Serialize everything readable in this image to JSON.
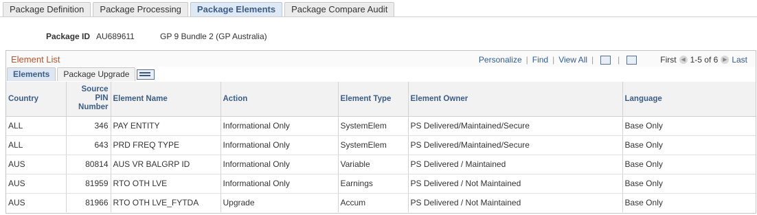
{
  "tabs": [
    "Package Definition",
    "Package Processing",
    "Package Elements",
    "Package Compare Audit"
  ],
  "package": {
    "label": "Package ID",
    "id": "AU689611",
    "description": "GP 9 Bundle 2 (GP Australia)"
  },
  "grid": {
    "title": "Element List",
    "nav": {
      "personalize": "Personalize",
      "find": "Find",
      "view_all": "View All",
      "first": "First",
      "range": "1-5 of 6",
      "last": "Last"
    },
    "subtabs": [
      "Elements",
      "Package Upgrade"
    ],
    "columns": [
      "Country",
      "Source PIN Number",
      "Element Name",
      "Action",
      "Element Type",
      "Element Owner",
      "Language"
    ],
    "rows": [
      [
        "ALL",
        "346",
        "PAY ENTITY",
        "Informational Only",
        "SystemElem",
        "PS Delivered/Maintained/Secure",
        "Base Only"
      ],
      [
        "ALL",
        "643",
        "PRD FREQ TYPE",
        "Informational Only",
        "SystemElem",
        "PS Delivered/Maintained/Secure",
        "Base Only"
      ],
      [
        "AUS",
        "80814",
        "AUS VR BALGRP ID",
        "Informational Only",
        "Variable",
        "PS Delivered / Maintained",
        "Base Only"
      ],
      [
        "AUS",
        "81959",
        "RTO OTH LVE",
        "Informational Only",
        "Earnings",
        "PS Delivered / Not Maintained",
        "Base Only"
      ],
      [
        "AUS",
        "81966",
        "RTO OTH LVE_FYTDA",
        "Upgrade",
        "Accum",
        "PS Delivered / Not Maintained",
        "Base Only"
      ]
    ]
  },
  "icons": {
    "zoom": "zoom-grid-icon",
    "download": "download-icon",
    "prev": "previous-arrow-icon",
    "next": "next-arrow-icon",
    "show_all": "show-all-columns-icon"
  },
  "colors": {
    "title": "#b3542d",
    "link": "#2f5b91",
    "header_text": "#3b5d86",
    "active_tab": "#dfe9f5"
  }
}
